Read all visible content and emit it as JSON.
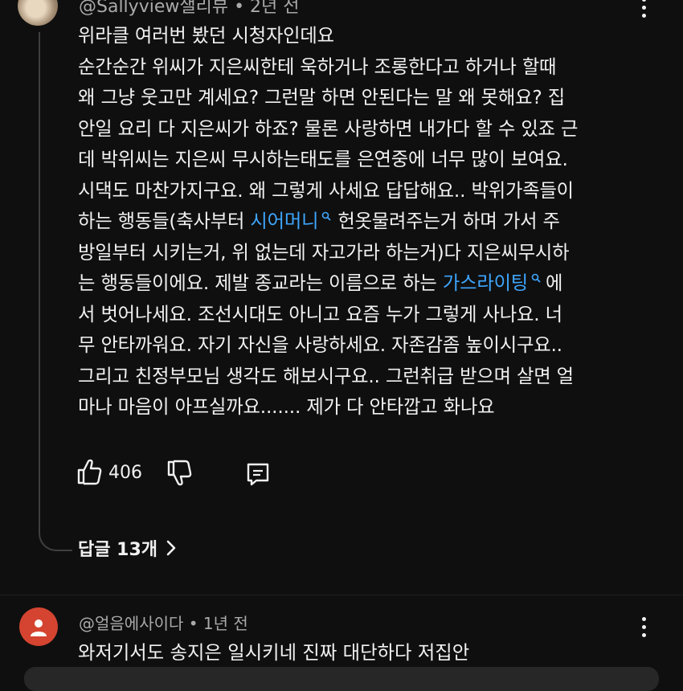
{
  "comment1": {
    "author": "@Sallyview샐리뷰",
    "time": "• 2년 전",
    "lines": [
      "위라클 여러번 봤던 시청자인데요",
      "순간순간 위씨가 지은씨한테 욱하거나 조롱한다고 하거나 할때",
      "왜 그냥 웃고만 계세요? 그런말 하면 안된다는 말 왜 못해요? 집",
      "안일 요리 다 지은씨가 하죠? 물론 사랑하면 내가다 할 수 있죠 근",
      "데 박위씨는 지은씨 무시하는태도를 은연중에 너무 많이 보여요.",
      "시댁도 마찬가지구요. 왜 그렇게 사세요 답답해요.. 박위가족들이"
    ],
    "line7_pre": "하는 행동들(축사부터 ",
    "link1": "시어머니",
    "line7_post": "헌옷물려주는거 하며 가서 주",
    "line8": "방일부터 시키는거, 위 없는데 자고가라 하는거)다 지은씨무시하",
    "line9_pre": "는 행동들이에요. 제발 종교라는 이름으로 하는 ",
    "link2": "가스라이팅",
    "line9_post": "에",
    "lines_rest": [
      "서 벗어나세요. 조선시대도 아니고 요즘 누가 그렇게 사나요. 너",
      "무 안타까워요. 자기 자신을 사랑하세요. 자존감좀 높이시구요..",
      "그리고 친정부모님 생각도 해보시구요.. 그런취급 받으며 살면 얼",
      "마나 마음이 아프실까요....... 제가 다 안타깝고 화나요"
    ],
    "likes": "406",
    "replies_label": "답글 13개"
  },
  "comment2": {
    "author": "@얼음에사이다",
    "time": "• 1년 전",
    "text": "와저기서도 송지은 일시키네 진짜 대단하다 저집안"
  },
  "icons": {
    "like": "thumbs-up-icon",
    "dislike": "thumbs-down-icon",
    "reply": "comment-icon",
    "more": "more-vert-icon",
    "search": "search-icon",
    "chevron": "chevron-right-icon"
  },
  "colors": {
    "background": "#0f0f0f",
    "text": "#f1f1f1",
    "secondary": "#aaaaaa",
    "link": "#3ea6ff",
    "avatar2": "#d44430"
  }
}
